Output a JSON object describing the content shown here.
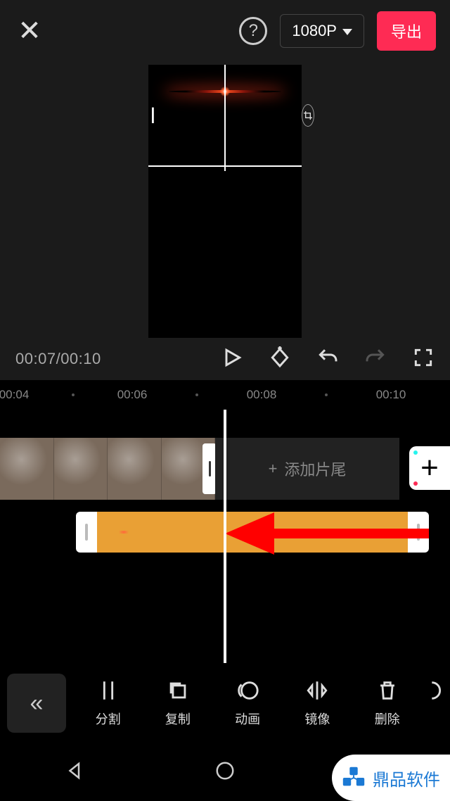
{
  "header": {
    "resolution": "1080P",
    "export": "导出"
  },
  "player": {
    "current": "00:07",
    "sep": "/",
    "total": "00:10"
  },
  "ruler": {
    "t0": "00:04",
    "t1": "00:06",
    "t2": "00:08",
    "t3": "00:10"
  },
  "timeline": {
    "add_tail": "添加片尾",
    "plus": "+"
  },
  "tools": {
    "split": "分割",
    "copy": "复制",
    "animate": "动画",
    "mirror": "镜像",
    "delete": "删除"
  },
  "watermark": "鼎品软件"
}
